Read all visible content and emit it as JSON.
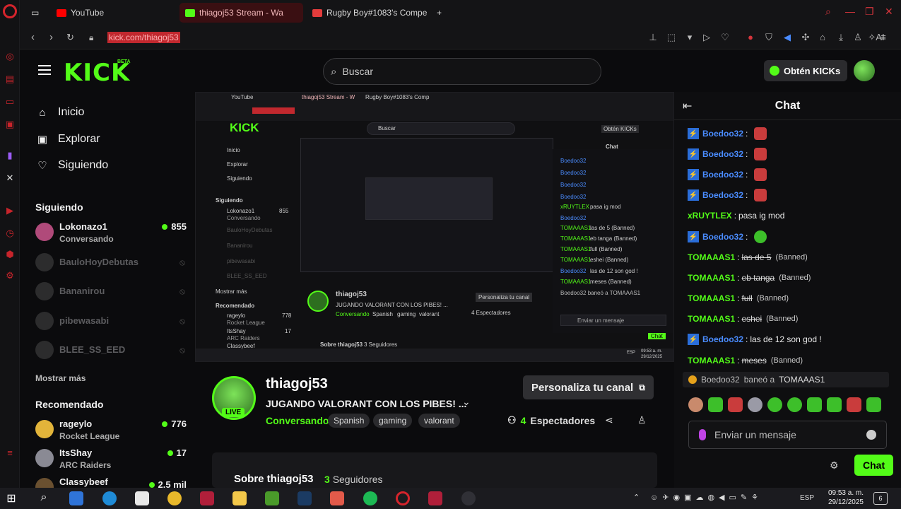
{
  "browser": {
    "tabs": [
      {
        "label": "YouTube",
        "color": "#ff0000"
      },
      {
        "label": "thiagoj53 Stream - Wa",
        "color": "#53fc18"
      },
      {
        "label": "Rugby Boy#1083's Compe",
        "color": "#e33c3c"
      }
    ],
    "new_tab": "+",
    "url": "kick.com/thiagoj53"
  },
  "header": {
    "logo": "KICK",
    "logo_badge": "BETA",
    "search_placeholder": "Buscar",
    "get_kicks": "Obtén KICKs"
  },
  "nav": {
    "home": "Inicio",
    "explore": "Explorar",
    "following": "Siguiendo"
  },
  "following_section": {
    "title": "Siguiendo",
    "items": [
      {
        "name": "Lokonazo1",
        "sub": "Conversando",
        "count": "855"
      },
      {
        "name": "BauloHoyDebutas"
      },
      {
        "name": "Bananirou"
      },
      {
        "name": "pibewasabi"
      },
      {
        "name": "BLEE_SS_EED"
      }
    ],
    "show_more": "Mostrar más"
  },
  "recommended_section": {
    "title": "Recomendado",
    "items": [
      {
        "name": "rageylo",
        "sub": "Rocket League",
        "count": "776"
      },
      {
        "name": "ItsShay",
        "sub": "ARC Raiders",
        "count": "17"
      },
      {
        "name": "Classybeef",
        "sub": "",
        "count": "2.5 mil"
      }
    ]
  },
  "stream": {
    "streamer": "thiagoj53",
    "title": "JUGANDO VALORANT CON LOS PIBES! ...",
    "category": "Conversando",
    "tags": [
      "Spanish",
      "gaming",
      "valorant"
    ],
    "live": "LIVE",
    "customize": "Personaliza tu canal",
    "viewers_count": "4",
    "viewers_label": "Espectadores",
    "about_title": "Sobre thiagoj53",
    "followers_count": "3",
    "followers_label": "Seguidores"
  },
  "video_mirror": {
    "tabs": [
      "YouTube",
      "thiagoj53 Stream - W",
      "Rugby Boy#1083's Comp"
    ],
    "search": "Buscar",
    "get_kicks": "Obtén KICKs",
    "nav": [
      "Inicio",
      "Explorar",
      "Siguiendo"
    ],
    "following_title": "Siguiendo",
    "following": [
      {
        "name": "Lokonazo1",
        "sub": "Conversando",
        "count": "855"
      },
      {
        "name": "BauloHoyDebutas"
      },
      {
        "name": "Bananirou"
      },
      {
        "name": "pibewasabi"
      },
      {
        "name": "BLEE_SS_EED"
      }
    ],
    "show_more": "Mostrar más",
    "recommended_title": "Recomendado",
    "recommended": [
      {
        "name": "rageylo",
        "sub": "Rocket League",
        "count": "778"
      },
      {
        "name": "ItsShay",
        "sub": "ARC Raiders",
        "count": "17"
      },
      {
        "name": "Classybeef"
      }
    ],
    "streamer": "thiagoj53",
    "title": "JUGANDO VALORANT CON LOS PIBES! ...",
    "category": "Conversando",
    "tags": [
      "Spanish",
      "gaming",
      "valorant"
    ],
    "customize": "Personaliza tu canal",
    "viewers": "4 Espectadores",
    "about": "Sobre thiagoj53",
    "followers": "3 Seguidores",
    "chat_title": "Chat",
    "chat": [
      {
        "user": "Boedoo32"
      },
      {
        "user": "Boedoo32"
      },
      {
        "user": "Boedoo32"
      },
      {
        "user": "Boedoo32"
      },
      {
        "user": "xRUYTLEX",
        "text": "pasa ig mod"
      },
      {
        "user": "Boedoo32"
      },
      {
        "user": "TOMAAAS1",
        "text": "las de 5 (Banned)"
      },
      {
        "user": "TOMAAAS1",
        "text": "eb tanga (Banned)"
      },
      {
        "user": "TOMAAAS1",
        "text": "full (Banned)"
      },
      {
        "user": "TOMAAAS1",
        "text": "eshei (Banned)"
      },
      {
        "user": "Boedoo32",
        "text": "las de 12 son god !"
      },
      {
        "user": "TOMAAAS1",
        "text": "meses (Banned)"
      }
    ],
    "ban_notice": "Boedoo32 baneó a TOMAAAS1",
    "input": "Enviar un mensaje",
    "send": "Chat",
    "time": "09:53 a. m.",
    "date": "29/12/2025",
    "lang": "ESP"
  },
  "chat": {
    "title": "Chat",
    "messages": [
      {
        "user": "Boedoo32",
        "color": "#4a8cff",
        "emote": "red"
      },
      {
        "user": "Boedoo32",
        "color": "#4a8cff",
        "emote": "red"
      },
      {
        "user": "Boedoo32",
        "color": "#4a8cff",
        "emote": "red"
      },
      {
        "user": "Boedoo32",
        "color": "#4a8cff",
        "emote": "red"
      },
      {
        "user": "xRUYTLEX",
        "color": "#53fc18",
        "text": "pasa ig mod"
      },
      {
        "user": "Boedoo32",
        "color": "#4a8cff",
        "emote": "green"
      },
      {
        "user": "TOMAAAS1",
        "color": "#53fc18",
        "text": "las de 5",
        "banned": "(Banned)"
      },
      {
        "user": "TOMAAAS1",
        "color": "#53fc18",
        "text": "eb tanga",
        "banned": "(Banned)"
      },
      {
        "user": "TOMAAAS1",
        "color": "#53fc18",
        "text": "full",
        "banned": "(Banned)"
      },
      {
        "user": "TOMAAAS1",
        "color": "#53fc18",
        "text": "eshei",
        "banned": "(Banned)"
      },
      {
        "user": "Boedoo32",
        "color": "#4a8cff",
        "text": "las de 12 son god !"
      },
      {
        "user": "TOMAAAS1",
        "color": "#53fc18",
        "text": "meses",
        "banned": "(Banned)"
      }
    ],
    "ban_user": "Boedoo32",
    "ban_action": "baneó a",
    "ban_target": "TOMAAAS1",
    "input_placeholder": "Enviar un mensaje",
    "send": "Chat"
  },
  "taskbar": {
    "lang": "ESP",
    "time": "09:53 a. m.",
    "date": "29/12/2025",
    "notifications": "6"
  }
}
